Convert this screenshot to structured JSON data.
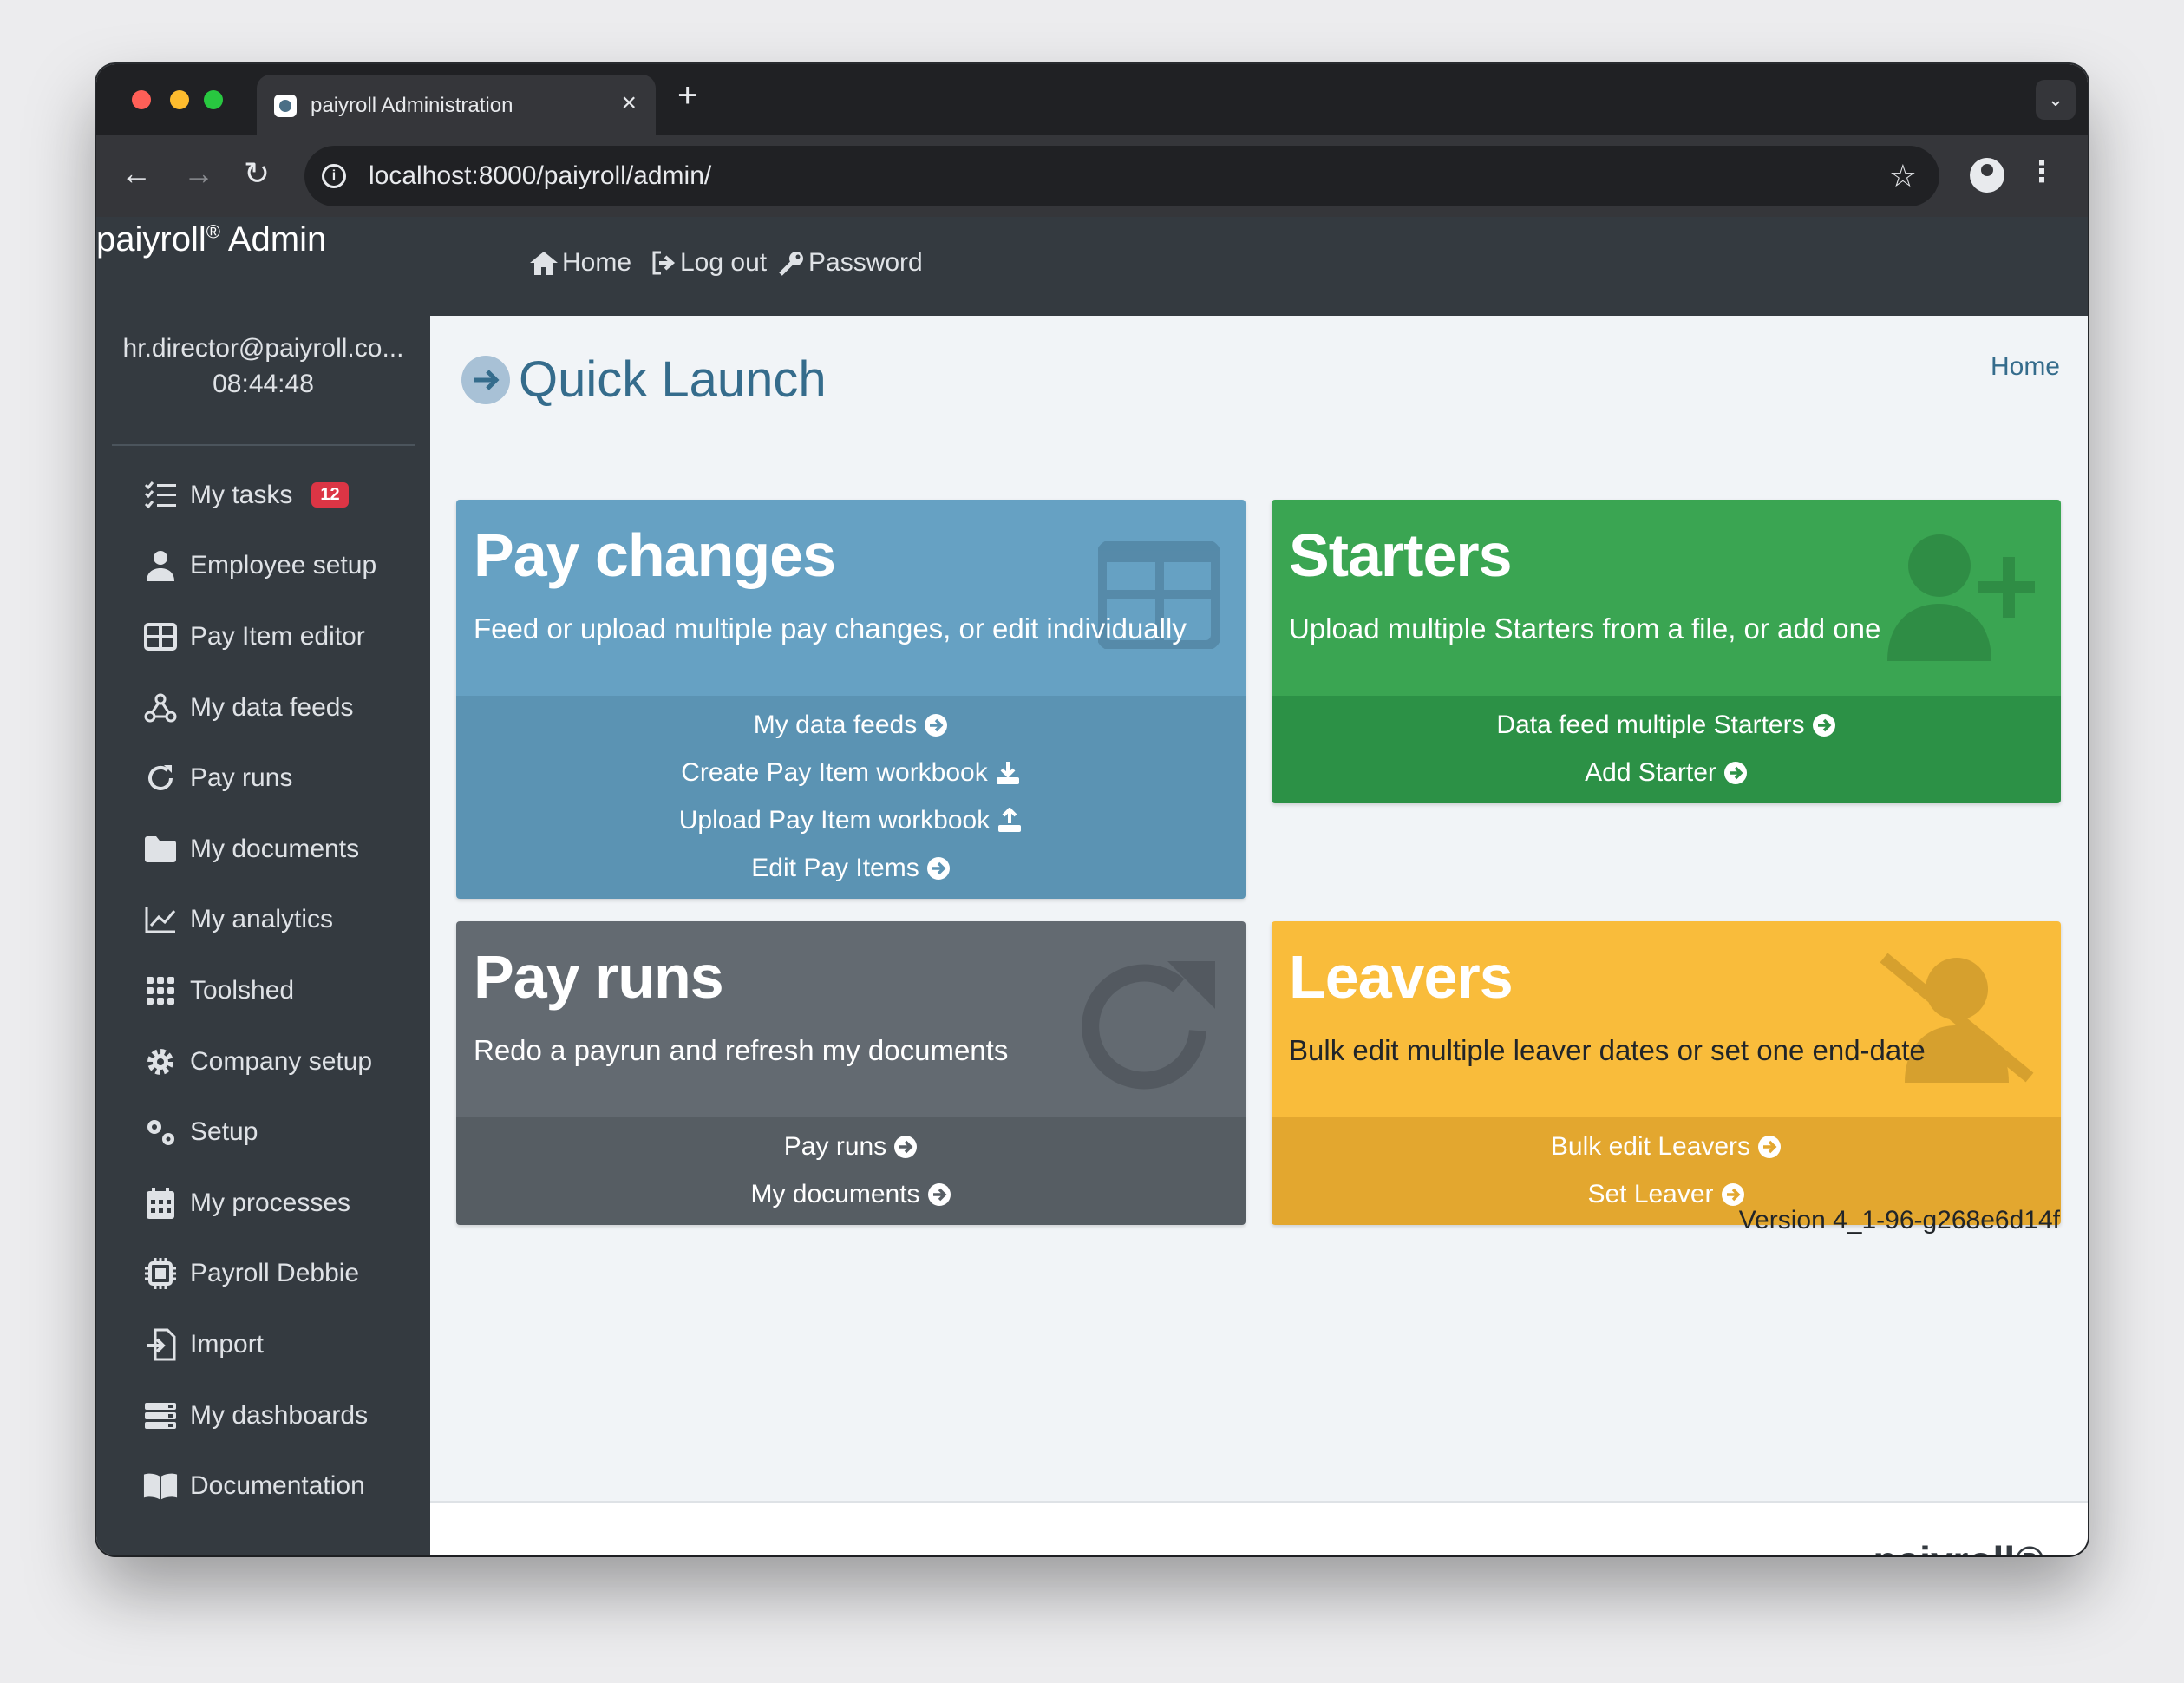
{
  "browser": {
    "tab_title": "paiyroll Administration",
    "tab_close": "×",
    "new_tab": "+",
    "url": "localhost:8000/paiyroll/admin/",
    "back": "←",
    "forward": "→",
    "reload": "↻",
    "star": "☆",
    "tab_menu": "⌄",
    "kebab": "⋮",
    "traffic_colors": [
      "#ff5f57",
      "#febc2e",
      "#28c840"
    ]
  },
  "sidebar": {
    "brand": "paiyroll",
    "brand_mark": "®",
    "brand_suffix": " Admin",
    "user_email": "hr.director@paiyroll.co...",
    "user_time": "08:44:48",
    "items": [
      {
        "label": "My tasks",
        "icon": "tasks-icon",
        "badge": "12"
      },
      {
        "label": "Employee setup",
        "icon": "user-icon"
      },
      {
        "label": "Pay Item editor",
        "icon": "table-icon"
      },
      {
        "label": "My data feeds",
        "icon": "webhook-icon"
      },
      {
        "label": "Pay runs",
        "icon": "refresh-icon"
      },
      {
        "label": "My documents",
        "icon": "folder-icon"
      },
      {
        "label": "My analytics",
        "icon": "line-chart-icon"
      },
      {
        "label": "Toolshed",
        "icon": "grid-icon"
      },
      {
        "label": "Company setup",
        "icon": "gear-icon"
      },
      {
        "label": "Setup",
        "icon": "gears-icon"
      },
      {
        "label": "My processes",
        "icon": "calendar-icon"
      },
      {
        "label": "Payroll Debbie",
        "icon": "chip-icon"
      },
      {
        "label": "Import",
        "icon": "import-icon"
      },
      {
        "label": "My dashboards",
        "icon": "dashboard-icon"
      },
      {
        "label": "Documentation",
        "icon": "book-icon"
      }
    ]
  },
  "topnav": {
    "home": "Home",
    "logout": "Log out",
    "password": "Password"
  },
  "main": {
    "title": "Quick Launch",
    "breadcrumb": "Home",
    "version": "Version 4_1-96-g268e6d14f",
    "footer_logo": "paiyroll®",
    "cards": {
      "pay_changes": {
        "title": "Pay changes",
        "subtitle": "Feed or upload multiple pay changes, or edit individually",
        "links": [
          "My data feeds",
          "Create Pay Item workbook",
          "Upload Pay Item workbook",
          "Edit Pay Items"
        ]
      },
      "starters": {
        "title": "Starters",
        "subtitle": "Upload multiple Starters from a file, or add one",
        "links": [
          "Data feed multiple Starters",
          "Add Starter"
        ]
      },
      "pay_runs": {
        "title": "Pay runs",
        "subtitle": "Redo a payrun and refresh my documents",
        "links": [
          "Pay runs",
          "My documents"
        ]
      },
      "leavers": {
        "title": "Leavers",
        "subtitle": "Bulk edit multiple leaver dates or set one end-date",
        "links": [
          "Bulk edit Leavers",
          "Set Leaver"
        ]
      }
    }
  },
  "colors": {
    "sidebar_bg": "#343a40",
    "accent": "#356c8c",
    "card_blue": "#66a1c3",
    "card_green": "#3aa552",
    "card_grey": "#636a71",
    "card_yellow": "#f9bc3b",
    "badge_red": "#dc3545"
  }
}
